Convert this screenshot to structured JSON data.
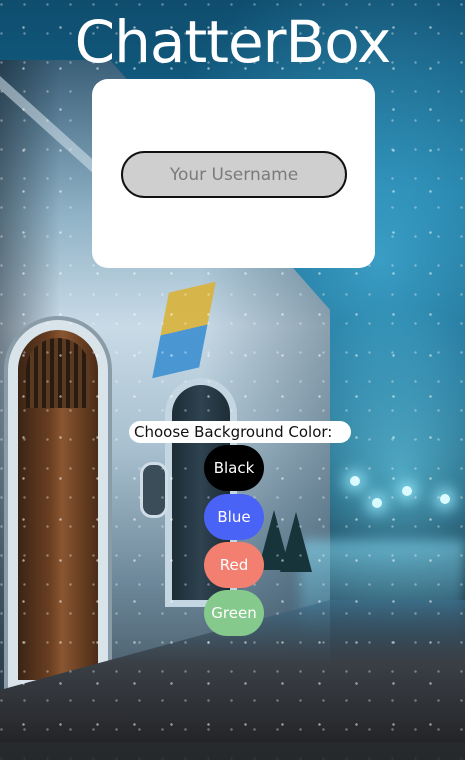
{
  "app": {
    "title": "ChatterBox"
  },
  "login": {
    "username_placeholder": "Your Username",
    "username_value": ""
  },
  "background_picker": {
    "label": "Choose Background Color:",
    "options": [
      {
        "label": "Black",
        "color": "#000000"
      },
      {
        "label": "Blue",
        "color": "#4a63f7"
      },
      {
        "label": "Red",
        "color": "#f27f6f"
      },
      {
        "label": "Green",
        "color": "#86c98d"
      }
    ]
  },
  "colors": {
    "card": "#ffffff",
    "input_fill": "#cfcfcf",
    "title_text": "#ffffff"
  }
}
